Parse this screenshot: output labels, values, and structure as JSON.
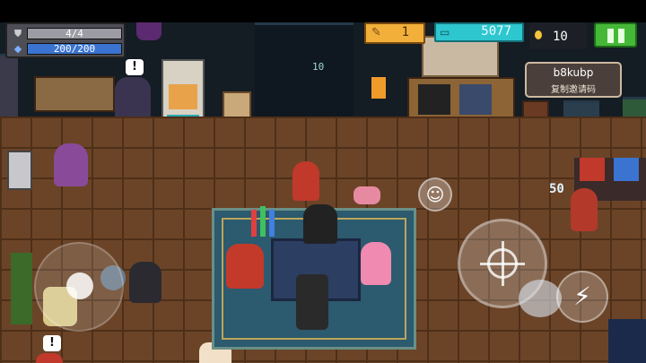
{
  "hud": {
    "shield": {
      "icon": "shield-icon",
      "value": "4/4",
      "fraction": 1.0,
      "color": "#9c9ca4"
    },
    "energy": {
      "icon": "diamond-icon",
      "value": "200/200",
      "fraction": 1.0,
      "color": "#3b74d0"
    },
    "gems": {
      "icon": "feather-icon",
      "value": "1"
    },
    "coins": {
      "icon": "coin-ticket-icon",
      "value": "5077"
    },
    "gold": {
      "icon": "gold-coin-icon",
      "value": "10"
    },
    "pause_icon": "pause-icon"
  },
  "invite": {
    "code": "b8kubp",
    "label": "复制邀请码"
  },
  "scene": {
    "sign_text": "10",
    "floating_number": "50",
    "alert_mark": "!"
  },
  "controls": {
    "joystick_icon": "joystick-icon",
    "attack_icon": "crosshair-icon",
    "skill_icon": "lightning-icon",
    "emote_icon": "smiley-icon",
    "swap_icon": "weapon-swap-icon"
  },
  "colors": {
    "floor": "#6b4428",
    "carpet": "#2c5a6e",
    "gem_bg": "#f2b03a",
    "coin_bg": "#2ec6cf",
    "pause_bg": "#46b838"
  }
}
